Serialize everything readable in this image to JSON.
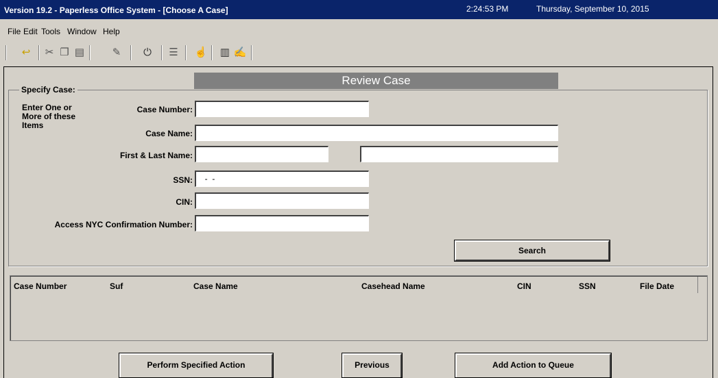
{
  "window": {
    "title": "Version 19.2 - Paperless Office System - [Choose A Case]",
    "time": "2:24:53 PM",
    "date": "Thursday, September 10, 2015"
  },
  "menu": [
    "File",
    "Edit",
    "Tools",
    "Window",
    "Help"
  ],
  "toolbar": {
    "icons": [
      "undo-icon",
      "cut-icon",
      "copy-icon",
      "paste-icon",
      "eraser-icon",
      "plug-icon",
      "list-icon",
      "hand-icon",
      "book-icon",
      "notepad-icon"
    ]
  },
  "banner": "Review Case",
  "specify": {
    "group_label": "Specify Case:",
    "note_lines": [
      "Enter One or",
      "More of these",
      "Items"
    ],
    "case_number_label": "Case Number:",
    "case_number_value": "",
    "case_name_label": "Case Name:",
    "case_name_value": "",
    "first_last_label": "First & Last Name:",
    "first_name_value": "",
    "last_name_value": "",
    "ssn_label": "SSN:",
    "ssn_value": "  -  -",
    "cin_label": "CIN:",
    "cin_value": "",
    "access_label": "Access NYC Confirmation Number:",
    "access_value": "",
    "search_label": "Search"
  },
  "results": {
    "columns": [
      "Case Number",
      "Suf",
      "Case Name",
      "Casehead Name",
      "CIN",
      "SSN",
      "File Date"
    ]
  },
  "actions": {
    "perform": "Perform Specified Action",
    "previous": "Previous",
    "add_queue": "Add Action to Queue"
  }
}
